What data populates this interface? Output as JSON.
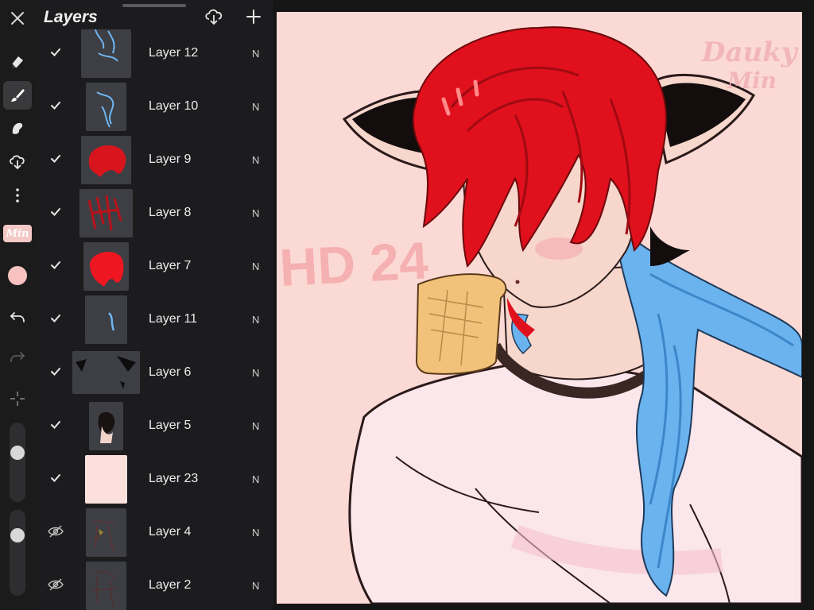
{
  "panel": {
    "title": "Layers",
    "layers": [
      {
        "name": "Layer 12",
        "blend": "N",
        "visible": true
      },
      {
        "name": "Layer 10",
        "blend": "N",
        "visible": true
      },
      {
        "name": "Layer 9",
        "blend": "N",
        "visible": true
      },
      {
        "name": "Layer 8",
        "blend": "N",
        "visible": true
      },
      {
        "name": "Layer 7",
        "blend": "N",
        "visible": true
      },
      {
        "name": "Layer 11",
        "blend": "N",
        "visible": true
      },
      {
        "name": "Layer 6",
        "blend": "N",
        "visible": true
      },
      {
        "name": "Layer 5",
        "blend": "N",
        "visible": true
      },
      {
        "name": "Layer 23",
        "blend": "N",
        "visible": true
      },
      {
        "name": "Layer 4",
        "blend": "N",
        "visible": false
      },
      {
        "name": "Layer 2",
        "blend": "N",
        "visible": false
      }
    ]
  },
  "toolbar": {
    "brush_label": "Min",
    "current_color": "#f7c2c0",
    "brush_size_level": 0.35,
    "opacity_level": 0.75,
    "icons": [
      "close-icon",
      "eraser-icon",
      "brush-icon",
      "smudge-icon",
      "import-icon",
      "more-icon",
      "undo-icon",
      "redo-icon",
      "transform-icon"
    ]
  },
  "canvas": {
    "watermark": "HD 24",
    "signature": "Dauky Min",
    "background": "#fbd9d4"
  },
  "colors": {
    "panel": "#1c1c1e",
    "hair_red": "#e0101c",
    "hair_blue": "#6ab3ef",
    "skin": "#f7d6cc"
  }
}
